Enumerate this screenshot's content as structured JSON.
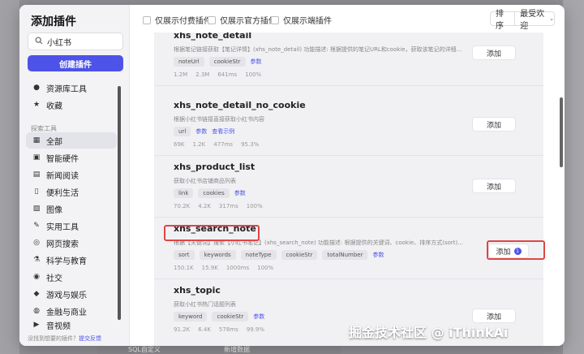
{
  "modal": {
    "title": "添加插件"
  },
  "search": {
    "value": "小红书"
  },
  "create_button": "创建插件",
  "sidebar": {
    "top_items": [
      {
        "icon": "person-icon",
        "label": "资源库工具"
      },
      {
        "icon": "star-icon",
        "label": "收藏"
      }
    ],
    "section_label": "探索工具",
    "items": [
      {
        "icon": "grid-icon",
        "label": "全部",
        "active": true
      },
      {
        "icon": "chip-icon",
        "label": "智能硬件"
      },
      {
        "icon": "newspaper-icon",
        "label": "新闻阅读"
      },
      {
        "icon": "phone-icon",
        "label": "便利生活"
      },
      {
        "icon": "image-icon",
        "label": "图像"
      },
      {
        "icon": "wrench-icon",
        "label": "实用工具"
      },
      {
        "icon": "globe-icon",
        "label": "网页搜索"
      },
      {
        "icon": "flask-icon",
        "label": "科学与教育"
      },
      {
        "icon": "chat-icon",
        "label": "社交"
      },
      {
        "icon": "gamepad-icon",
        "label": "游戏与娱乐"
      },
      {
        "icon": "coin-icon",
        "label": "金融与商业"
      },
      {
        "icon": "video-icon",
        "label": "音视频"
      }
    ],
    "footer_text": "没找到想要的插件？",
    "footer_link": "提交反馈"
  },
  "filters": [
    "仅展示付费插件",
    "仅展示官方插件",
    "仅展示端插件"
  ],
  "sort": {
    "label": "排序",
    "value": "最受欢迎"
  },
  "plugins": [
    {
      "name": "xhs_note_detail",
      "desc": "根据笔记链接获取【笔记详情】(xhs_note_detail) 功能描述: 根据提供的笔记URL和cookie，获取该笔记的详细信...",
      "tags": [
        "noteUrl",
        "cookieStr"
      ],
      "links": [
        "参数"
      ],
      "stats": [
        "1.2M",
        "2.3M",
        "641ms",
        "100%"
      ],
      "add_label": "添加"
    },
    {
      "name": "xhs_note_detail_no_cookie",
      "desc": "根据小红书链接直接获取小红书内容",
      "tags": [
        "url"
      ],
      "links": [
        "参数",
        "查看示例"
      ],
      "stats": [
        "69K",
        "1.2K",
        "477ms",
        "95.3%"
      ],
      "add_label": "添加"
    },
    {
      "name": "xhs_product_list",
      "desc": "获取小红书店铺商品列表",
      "tags": [
        "link",
        "cookies"
      ],
      "links": [
        "参数"
      ],
      "stats": [
        "70.2K",
        "4.2K",
        "317ms",
        "100%"
      ],
      "add_label": "添加"
    },
    {
      "name": "xhs_search_note",
      "desc": "根据【关键词】搜索【小红书笔记】(xhs_search_note) 功能描述: 根据提供的关键词、cookie、排序方式(sort)...",
      "tags": [
        "sort",
        "keywords",
        "noteType",
        "cookieStr",
        "totalNumber"
      ],
      "links": [
        "参数"
      ],
      "stats": [
        "150.1K",
        "15.9K",
        "1000ms",
        "100%"
      ],
      "add_label": "添加",
      "badge": "1"
    },
    {
      "name": "xhs_topic",
      "desc": "获取小红书热门话题列表",
      "tags": [
        "keyword",
        "cookieStr"
      ],
      "links": [
        "参数"
      ],
      "stats": [
        "91.2K",
        "6.4K",
        "578ms",
        "99.9%"
      ],
      "add_label": "添加"
    }
  ],
  "watermark": "掘金技术社区 @ iThinkAi",
  "background": {
    "bottom_label_1": "SQL自定义",
    "bottom_label_2": "新增数据"
  },
  "colors": {
    "accent": "#4d53e8",
    "highlight": "#e04545"
  }
}
